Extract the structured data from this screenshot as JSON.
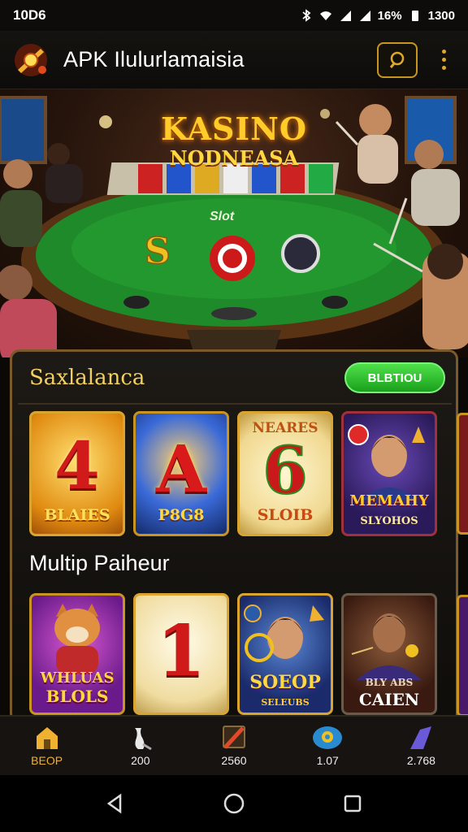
{
  "status": {
    "time": "10D6",
    "battery": "16%",
    "clock": "1300"
  },
  "appbar": {
    "title": "APK Ilulurlamaisia"
  },
  "hero": {
    "title_line1": "KASINO",
    "title_line2": "NODNEASA",
    "table_label": "Slot"
  },
  "featured": {
    "title": "Saxlalanca",
    "button_label": "BLBTIOU",
    "tiles": [
      {
        "big": "4",
        "label": "BLAIES",
        "top": ""
      },
      {
        "big": "A",
        "label": "P8G8",
        "top": ""
      },
      {
        "big": "6",
        "label": "SLOIB",
        "top": "NEARES"
      },
      {
        "big": "",
        "label": "MEMAHY",
        "sub": "SLYOHOS",
        "top": ""
      }
    ]
  },
  "multiplayer": {
    "title": "Multip Paiheur",
    "tiles": [
      {
        "big": "",
        "label": "WHLUAS",
        "sub": "BLOLS"
      },
      {
        "big": "1",
        "label": ""
      },
      {
        "big": "",
        "label": "SOEOP",
        "sub": "SELEUBS"
      },
      {
        "big": "",
        "label": "CAIEN",
        "sub": "BLY ABS"
      }
    ]
  },
  "bottom_nav": [
    {
      "label": "BEOP",
      "icon": "home-icon",
      "active": true
    },
    {
      "label": "200",
      "icon": "bowling-icon"
    },
    {
      "label": "2560",
      "icon": "stick-icon"
    },
    {
      "label": "1.07",
      "icon": "chip-icon"
    },
    {
      "label": "2.768",
      "icon": "arrow-icon"
    }
  ],
  "colors": {
    "accent": "#f0b030",
    "gold_border": "#d9a530",
    "green_button": "#2ec02c"
  }
}
